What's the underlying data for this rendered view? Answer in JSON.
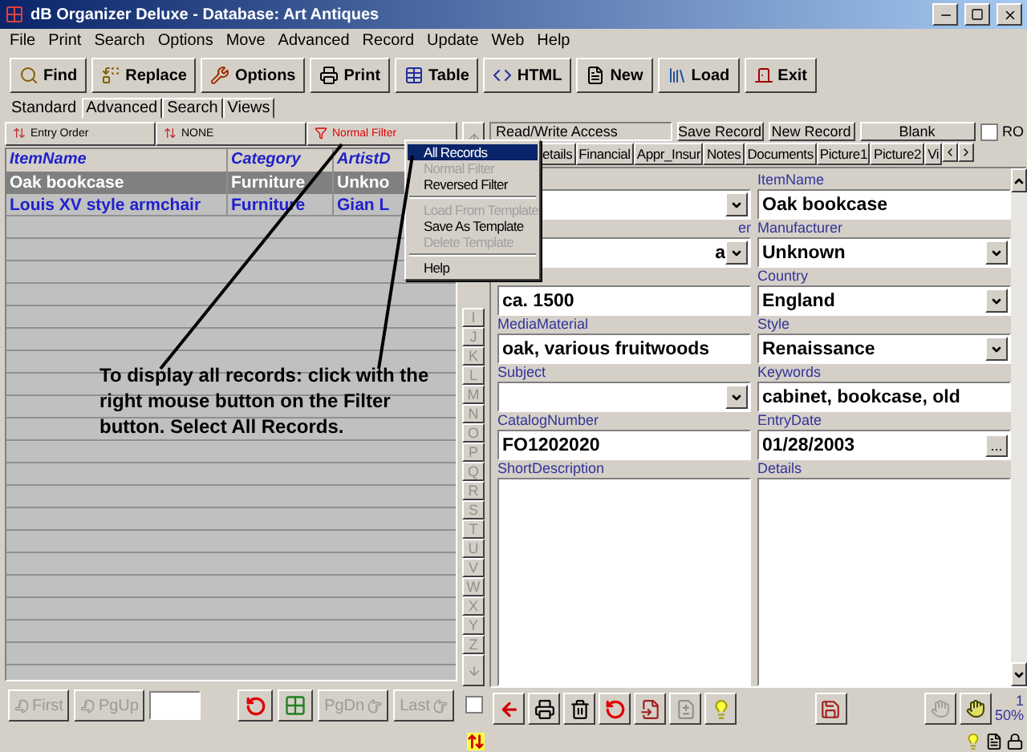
{
  "window": {
    "title": "dB Organizer Deluxe - Database: Art Antiques"
  },
  "menu": [
    "File",
    "Print",
    "Search",
    "Options",
    "Move",
    "Advanced",
    "Record",
    "Update",
    "Web",
    "Help"
  ],
  "toolbar": [
    "Find",
    "Replace",
    "Options",
    "Print",
    "Table",
    "HTML",
    "New",
    "Load",
    "Exit"
  ],
  "view_tabs": [
    {
      "label": "Standard",
      "selected": true
    },
    {
      "label": "Advanced",
      "selected": false
    },
    {
      "label": "Search",
      "selected": false
    },
    {
      "label": "Views",
      "selected": false
    }
  ],
  "filter_bar": [
    {
      "label": "Entry Order",
      "kind": "sort"
    },
    {
      "label": "NONE",
      "kind": "sort"
    },
    {
      "label": "Normal Filter",
      "kind": "filter"
    }
  ],
  "grid": {
    "columns": [
      "ItemName",
      "Category",
      "ArtistD"
    ],
    "rows": [
      {
        "cells": [
          "Oak bookcase",
          "Furniture",
          "Unkno"
        ],
        "selected": true
      },
      {
        "cells": [
          "Louis XV style armchair",
          "Furniture",
          "Gian L"
        ],
        "selected": false
      }
    ]
  },
  "context_menu": [
    {
      "kind": "item",
      "label": "All Records",
      "selected": true,
      "disabled": false
    },
    {
      "kind": "item",
      "label": "Normal Filter",
      "selected": false,
      "disabled": true
    },
    {
      "kind": "item",
      "label": "Reversed Filter",
      "selected": false,
      "disabled": false
    },
    {
      "kind": "separator"
    },
    {
      "kind": "item",
      "label": "Load From Template",
      "selected": false,
      "disabled": true
    },
    {
      "kind": "item",
      "label": "Save As Template",
      "selected": false,
      "disabled": false
    },
    {
      "kind": "item",
      "label": "Delete Template",
      "selected": false,
      "disabled": true
    },
    {
      "kind": "separator"
    },
    {
      "kind": "item",
      "label": "Help",
      "selected": false,
      "disabled": false
    }
  ],
  "letter_index": [
    "I",
    "J",
    "K",
    "L",
    "M",
    "N",
    "O",
    "P",
    "Q",
    "R",
    "S",
    "T",
    "U",
    "V",
    "W",
    "X",
    "Y",
    "Z"
  ],
  "index_checkbox": {
    "checked": false
  },
  "nav_buttons": [
    "First",
    "PgUp",
    "PgDn",
    "Last"
  ],
  "record_bar": {
    "access": "Read/Write Access",
    "buttons": [
      "Save Record",
      "New Record",
      "Blank"
    ],
    "ro": {
      "label": "RO",
      "checked": false
    }
  },
  "record_tabs": [
    {
      "label": "etails",
      "selected": false
    },
    {
      "label": "Financial",
      "selected": false
    },
    {
      "label": "Appr_Insur",
      "selected": false
    },
    {
      "label": "Notes",
      "selected": false
    },
    {
      "label": "Documents",
      "selected": false
    },
    {
      "label": "Picture1",
      "selected": false
    },
    {
      "label": "Picture2",
      "selected": false
    },
    {
      "label": "Vi",
      "selected": false
    }
  ],
  "form": {
    "left": [
      {
        "kind": "dropdown"
      },
      {
        "kind": "dropdown",
        "label": "er",
        "value": "a"
      },
      {
        "kind": "text",
        "value": "ca. 1500"
      },
      {
        "kind": "text",
        "label": "MediaMaterial",
        "value": "oak, various fruitwoods"
      },
      {
        "kind": "dropdown",
        "label": "Subject"
      },
      {
        "kind": "text",
        "label": "CatalogNumber",
        "value": "FO1202020"
      },
      {
        "kind": "memo",
        "label": "ShortDescription"
      }
    ],
    "right": [
      {
        "kind": "text",
        "label": "ItemName",
        "value": "Oak bookcase"
      },
      {
        "kind": "dropdown",
        "label": "Manufacturer",
        "value": "Unknown"
      },
      {
        "kind": "dropdown",
        "label": "Country",
        "value": "England"
      },
      {
        "kind": "dropdown",
        "label": "Style",
        "value": "Renaissance"
      },
      {
        "kind": "text",
        "label": "Keywords",
        "value": "cabinet, bookcase, old"
      },
      {
        "kind": "date",
        "label": "EntryDate",
        "value": "01/28/2003",
        "button": "..."
      },
      {
        "kind": "memo",
        "label": "Details"
      }
    ]
  },
  "record_status": {
    "record": "1",
    "zoom": "50%"
  },
  "annotation": {
    "text": "To display all records: click with the right mouse button on the Filter button. Select All Records."
  }
}
